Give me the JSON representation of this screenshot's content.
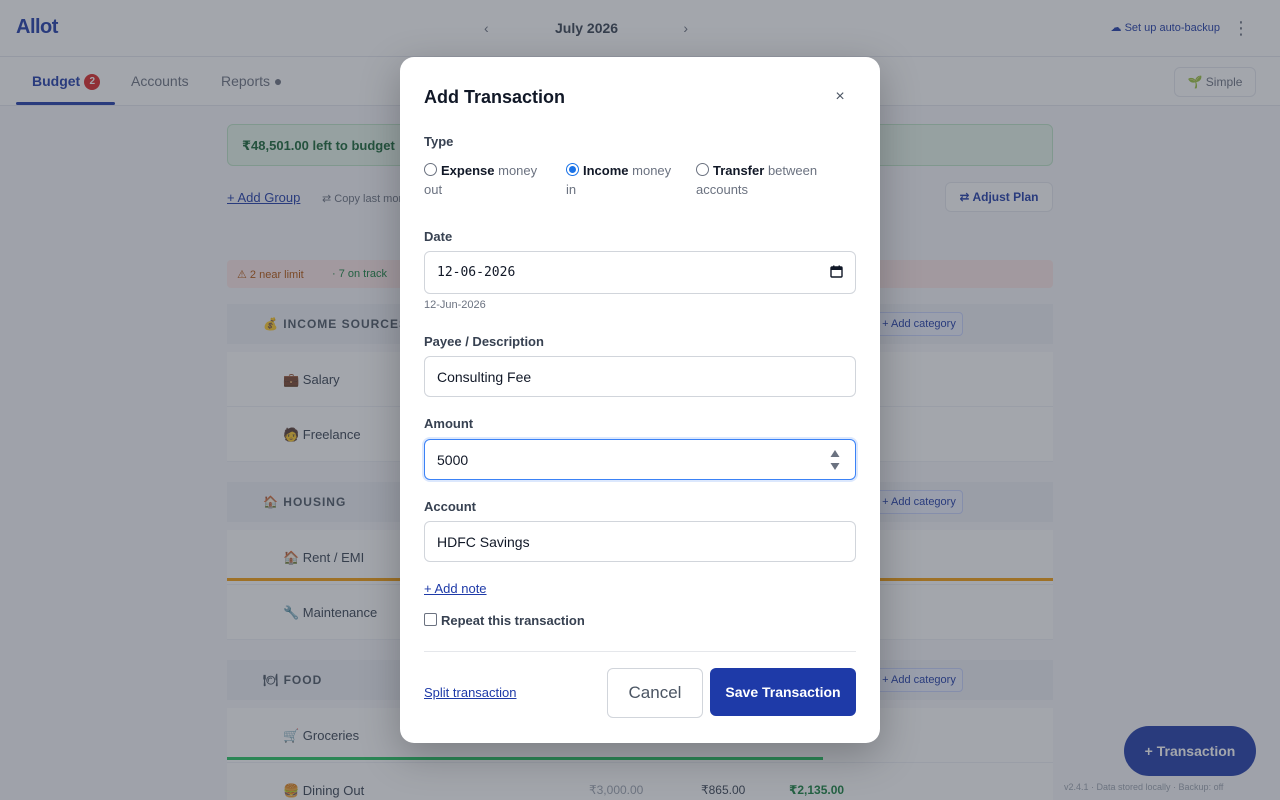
{
  "app": {
    "logo": "Allot",
    "month": "July 2026",
    "prev": "‹",
    "next": "›",
    "backup": "☁ Set up auto-backup",
    "kebab": "⋮",
    "tabs": [
      {
        "label": "Budget",
        "badge": "2"
      },
      {
        "label": "Accounts"
      },
      {
        "label": "Reports ●"
      }
    ],
    "mode_button": "🌱 Simple",
    "left_to_budget": "₹48,501.00 left to budget",
    "add_group": "+ Add Group",
    "copy_last": "⇄ Copy last month",
    "adjust_plan": "⇄ Adjust Plan",
    "alert_over": "⚠ 2 near limit",
    "alert_ok": "· 7 on track",
    "groups": [
      {
        "name": "💰 INCOME SOURCES",
        "add": "+ Add category"
      },
      {
        "name": "🏠 HOUSING",
        "add": "+ Add category"
      },
      {
        "name": "🍽 FOOD",
        "add": "+ Add category"
      }
    ],
    "rows": [
      {
        "name": "💼 Salary"
      },
      {
        "name": "🧑 Freelance"
      },
      {
        "name": "🏠 Rent / EMI"
      },
      {
        "name": "🔧 Maintenance"
      },
      {
        "name": "🛒 Groceries"
      },
      {
        "name": "🍔 Dining Out",
        "planned": "₹3,000.00",
        "spent": "₹865.00",
        "left": "₹2,135.00"
      }
    ],
    "fab": "+ Transaction",
    "version": "v2.4.1 · Data stored locally · Backup: off"
  },
  "modal": {
    "title": "Add Transaction",
    "close": "×",
    "type_label": "Type",
    "types": [
      {
        "bold": "Expense",
        "rest_line1": "money",
        "rest_line2": "out",
        "selected": false
      },
      {
        "bold": "Income",
        "rest_line1": "money",
        "rest_line2": "in",
        "selected": true
      },
      {
        "bold": "Transfer",
        "rest_line1": "between",
        "rest_line2": "accounts",
        "selected": false
      }
    ],
    "date_label": "Date",
    "date_value": "12-06-2026",
    "date_hint": "12-Jun-2026",
    "payee_label": "Payee / Description",
    "payee_value": "Consulting Fee",
    "amount_label": "Amount",
    "amount_value": "5000",
    "account_label": "Account",
    "account_value": "HDFC Savings",
    "add_note": "+ Add note",
    "repeat": "Repeat this transaction",
    "split": "Split transaction",
    "cancel": "Cancel",
    "save": "Save Transaction",
    "colors": {
      "primary": "#1e3aa8",
      "focus": "#3b82f6",
      "radio": "#1a73e8"
    }
  }
}
